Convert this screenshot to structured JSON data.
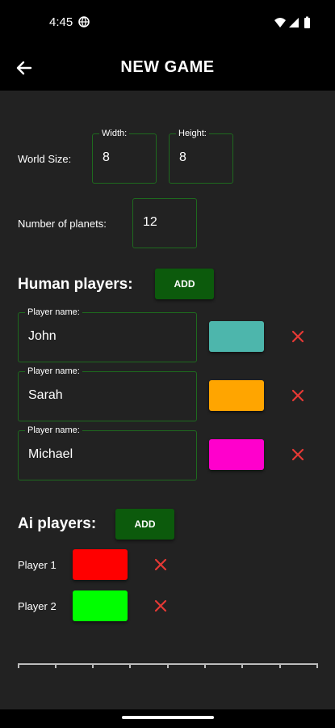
{
  "status_bar": {
    "time": "4:45"
  },
  "app_bar": {
    "title": "NEW GAME"
  },
  "world": {
    "label": "World Size:",
    "width_label": "Width:",
    "width_value": "8",
    "height_label": "Height:",
    "height_value": "8"
  },
  "planets": {
    "label": "Number of planets:",
    "value": "12"
  },
  "human": {
    "title": "Human players:",
    "add_label": "ADD",
    "field_label": "Player name:",
    "players": [
      {
        "name": "John",
        "color": "#4db6ac"
      },
      {
        "name": "Sarah",
        "color": "#ffa500"
      },
      {
        "name": "Michael",
        "color": "#ff00cc"
      }
    ]
  },
  "ai": {
    "title": "Ai players:",
    "add_label": "ADD",
    "players": [
      {
        "name": "Player 1",
        "color": "#ff0000"
      },
      {
        "name": "Player 2",
        "color": "#00ff00"
      }
    ]
  },
  "colors": {
    "accent": "#0c5a0c",
    "border": "#1e6a1e",
    "remove": "#e53935",
    "background": "#222222"
  }
}
